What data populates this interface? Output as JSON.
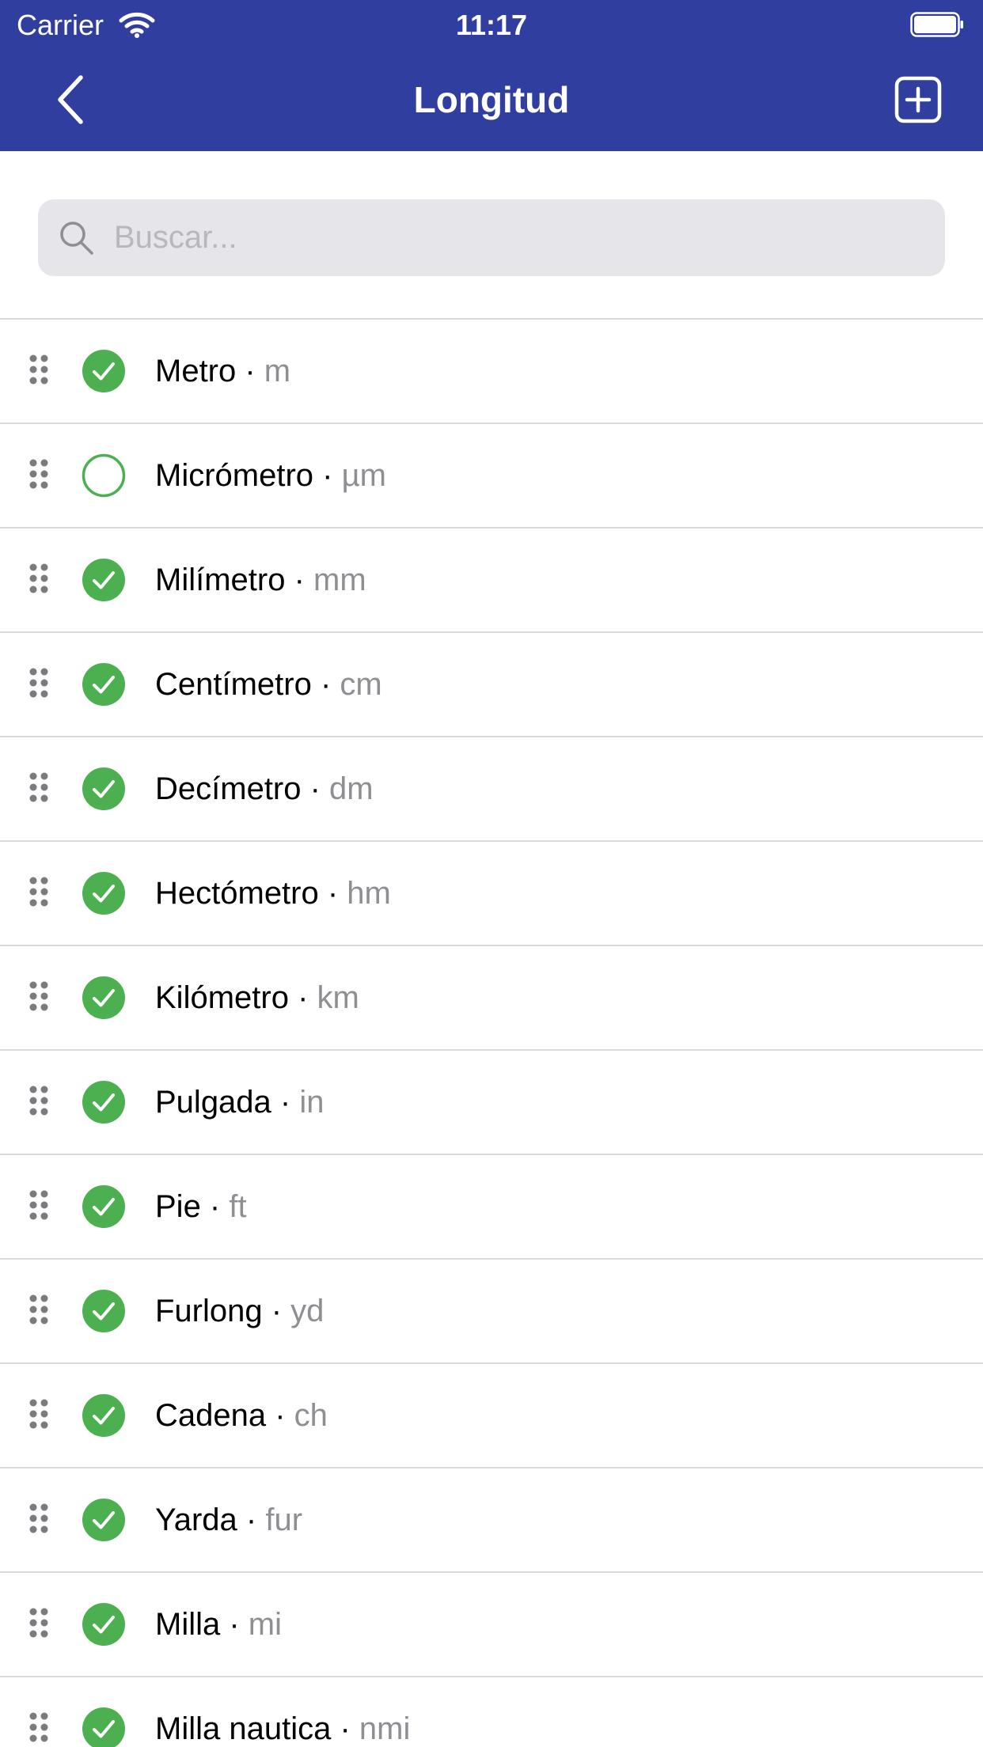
{
  "status_bar": {
    "carrier": "Carrier",
    "time": "11:17"
  },
  "navbar": {
    "title": "Longitud",
    "back_icon": "chevron-left-icon",
    "add_icon": "plus-square-icon"
  },
  "search": {
    "placeholder": "Buscar...",
    "value": ""
  },
  "colors": {
    "header": "#303f9f",
    "check": "#4caf50",
    "symbol": "#8e8e93"
  },
  "units": [
    {
      "name": "Metro",
      "symbol": "m",
      "enabled": true
    },
    {
      "name": "Micrómetro",
      "symbol": "µm",
      "enabled": false
    },
    {
      "name": "Milímetro",
      "symbol": "mm",
      "enabled": true
    },
    {
      "name": "Centímetro",
      "symbol": "cm",
      "enabled": true
    },
    {
      "name": "Decímetro",
      "symbol": "dm",
      "enabled": true
    },
    {
      "name": "Hectómetro",
      "symbol": "hm",
      "enabled": true
    },
    {
      "name": "Kilómetro",
      "symbol": "km",
      "enabled": true
    },
    {
      "name": "Pulgada",
      "symbol": "in",
      "enabled": true
    },
    {
      "name": "Pie",
      "symbol": "ft",
      "enabled": true
    },
    {
      "name": "Furlong",
      "symbol": "yd",
      "enabled": true
    },
    {
      "name": "Cadena",
      "symbol": "ch",
      "enabled": true
    },
    {
      "name": "Yarda",
      "symbol": "fur",
      "enabled": true
    },
    {
      "name": "Milla",
      "symbol": "mi",
      "enabled": true
    },
    {
      "name": "Milla nautica",
      "symbol": "nmi",
      "enabled": true
    }
  ]
}
